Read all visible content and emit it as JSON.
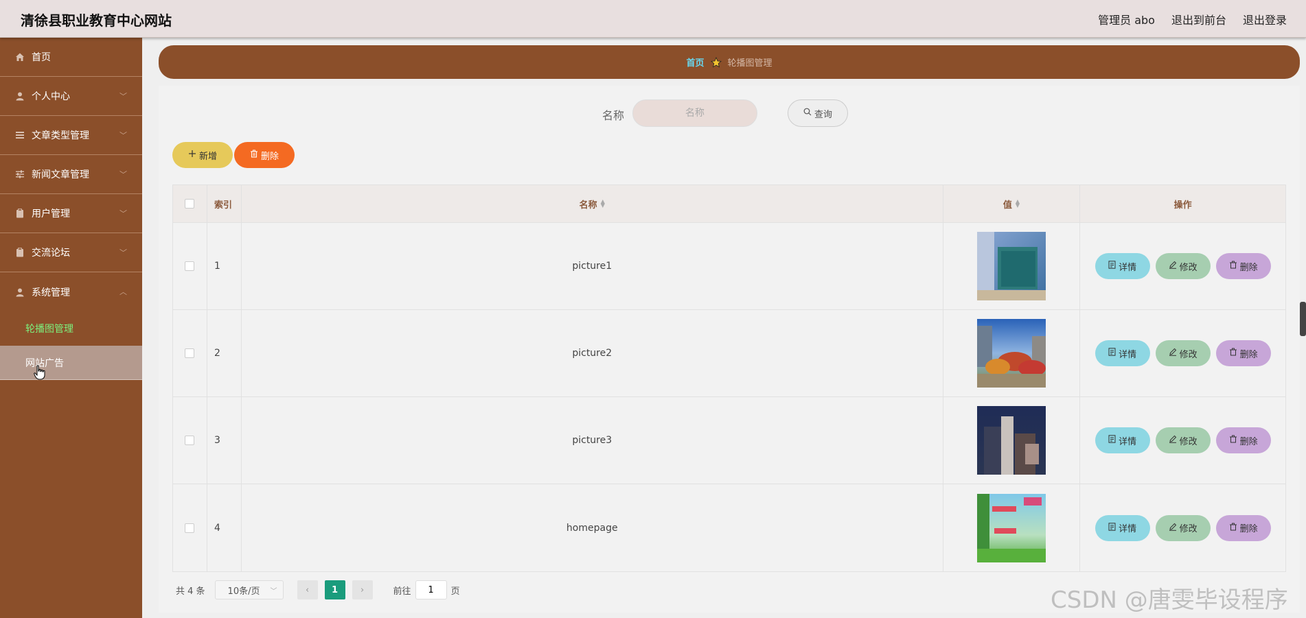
{
  "header": {
    "site_title": "清徐县职业教育中心网站",
    "admin_label": "管理员 abo",
    "to_frontend": "退出到前台",
    "logout": "退出登录"
  },
  "sidebar": {
    "items": [
      {
        "label": "首页",
        "icon": "home-icon"
      },
      {
        "label": "个人中心",
        "icon": "user-icon"
      },
      {
        "label": "文章类型管理",
        "icon": "list-icon"
      },
      {
        "label": "新闻文章管理",
        "icon": "sliders-icon"
      },
      {
        "label": "用户管理",
        "icon": "clipboard-icon"
      },
      {
        "label": "交流论坛",
        "icon": "clipboard-icon"
      },
      {
        "label": "系统管理",
        "icon": "user-icon"
      }
    ],
    "subitems": [
      {
        "label": "轮播图管理",
        "state": "active"
      },
      {
        "label": "网站广告",
        "state": "hover"
      }
    ]
  },
  "breadcrumb": {
    "home": "首页",
    "current": "轮播图管理"
  },
  "search": {
    "label": "名称",
    "placeholder": "名称",
    "button": "查询"
  },
  "actions": {
    "add": "新增",
    "delete": "删除"
  },
  "table": {
    "headers": {
      "index": "索引",
      "name": "名称",
      "value": "值",
      "ops": "操作"
    },
    "rows": [
      {
        "index": "1",
        "name": "picture1",
        "image": "school-hall-photo"
      },
      {
        "index": "2",
        "name": "picture2",
        "image": "campus-garden-photo"
      },
      {
        "index": "3",
        "name": "picture3",
        "image": "city-night-photo"
      },
      {
        "index": "4",
        "name": "homepage",
        "image": "homepage-banner-photo"
      }
    ],
    "op_labels": {
      "detail": "详情",
      "edit": "修改",
      "delete": "删除"
    }
  },
  "pagination": {
    "total": "共 4 条",
    "page_size": "10条/页",
    "current_page": "1",
    "goto_prefix": "前往",
    "goto_value": "1",
    "goto_suffix": "页"
  },
  "watermark": "CSDN @唐雯毕设程序",
  "colors": {
    "sidebar": "#8b4f2a",
    "topbar": "#e8dfdf",
    "add_button": "#e6c95a",
    "delete_button": "#f46a22",
    "detail_button": "#8ed7e3",
    "edit_button": "#a6ceb0",
    "row_delete_button": "#c7a6d8",
    "active_page": "#1a9c7c"
  }
}
